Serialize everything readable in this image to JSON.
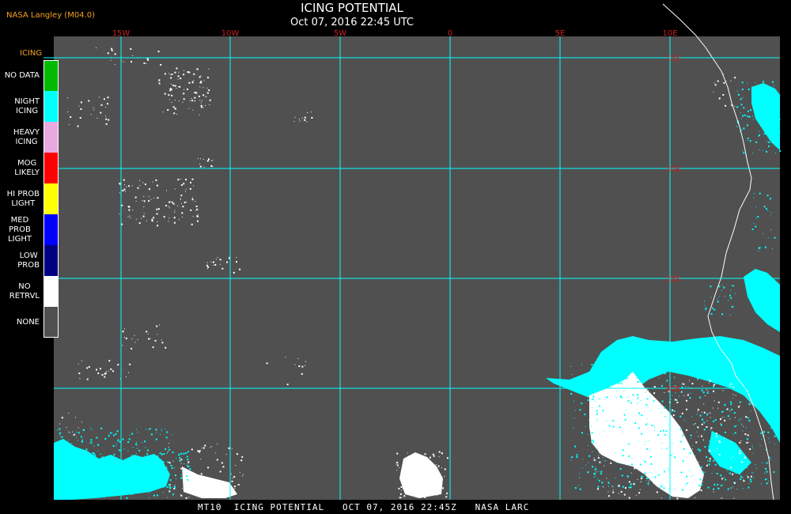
{
  "header": {
    "credit": "NASA Langley (M04.0)",
    "title": "ICING POTENTIAL",
    "datetime": "Oct 07, 2016 22:45 UTC"
  },
  "map": {
    "lon_labels": [
      "15W",
      "10W",
      "5W",
      "0",
      "5E",
      "10E"
    ],
    "lat_labels": [
      "15S",
      "20S",
      "25S",
      "30S"
    ],
    "colors": {
      "background": "#505050",
      "grid": "#00ffff",
      "grid_label": "#cc2222",
      "coast": "#ffffff",
      "night_icing": "#00ffff",
      "no_retrieval": "#ffffff"
    }
  },
  "legend": {
    "title": "ICING",
    "items": [
      {
        "label": "NO DATA",
        "color": "#00bb00"
      },
      {
        "label": "NIGHT\nICING",
        "color": "#00ffff"
      },
      {
        "label": "HEAVY\nICING",
        "color": "#e8a8e0"
      },
      {
        "label": "MOG\nLIKELY",
        "color": "#ff0000"
      },
      {
        "label": "HI PROB\nLIGHT",
        "color": "#ffff00"
      },
      {
        "label": "MED PROB\nLIGHT",
        "color": "#0000ff"
      },
      {
        "label": "LOW\nPROB",
        "color": "#000080"
      },
      {
        "label": "NO\nRETRVL",
        "color": "#ffffff"
      },
      {
        "label": "NONE",
        "color": "#505050"
      }
    ]
  },
  "footer": {
    "text": "MT10  ICING POTENTIAL   OCT 07, 2016 22:45Z   NASA LARC"
  }
}
